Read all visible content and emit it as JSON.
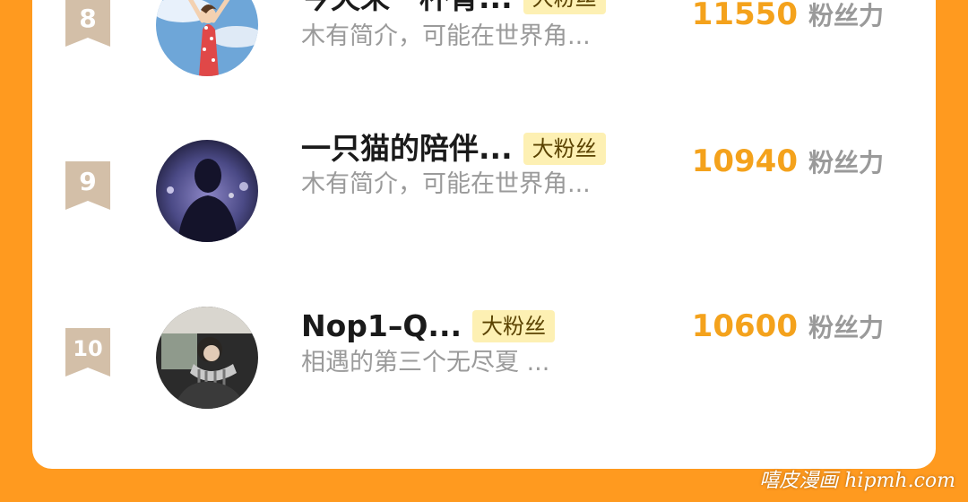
{
  "accent_color": "#ff9a1f",
  "score_color": "#f4a21c",
  "tag_bg": "#fdf0b3",
  "entries": [
    {
      "rank": "8",
      "name": "今天来一杯青...",
      "tag": "大粉丝",
      "bio": "木有简介，可能在世界角...",
      "score": "11550",
      "unit": "粉丝力",
      "avatar": "avatar-girl-sky"
    },
    {
      "rank": "9",
      "name": "一只猫的陪伴...",
      "tag": "大粉丝",
      "bio": "木有简介，可能在世界角...",
      "score": "10940",
      "unit": "粉丝力",
      "avatar": "avatar-silhouette-night"
    },
    {
      "rank": "10",
      "name": "Nop1–Q...",
      "tag": "大粉丝",
      "bio": "相遇的第三个无尽夏 ...",
      "score": "10600",
      "unit": "粉丝力",
      "avatar": "avatar-person-car"
    }
  ],
  "watermark": "嘻皮漫画 hipmh.com"
}
